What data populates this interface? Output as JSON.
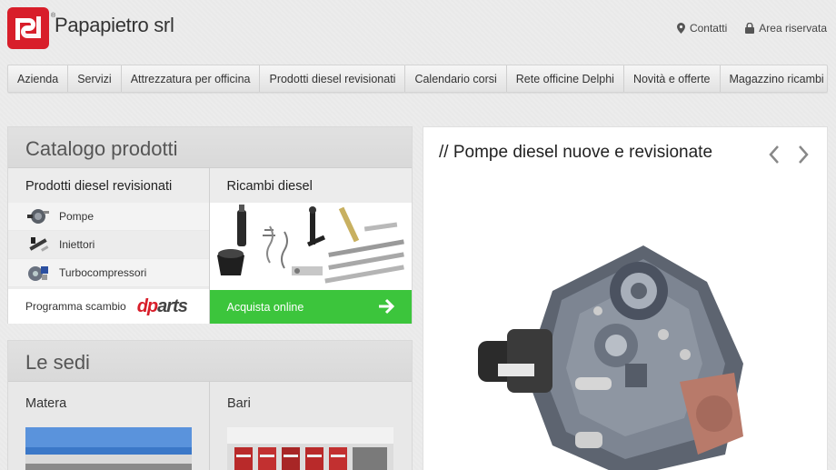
{
  "header": {
    "brand": "Papapietro srl",
    "reg_mark": "®",
    "links": [
      {
        "label": "Contatti",
        "icon": "map-pin-icon"
      },
      {
        "label": "Area riservata",
        "icon": "lock-icon"
      }
    ]
  },
  "nav": {
    "items": [
      "Azienda",
      "Servizi",
      "Attrezzatura per officina",
      "Prodotti diesel revisionati",
      "Calendario corsi",
      "Rete officine Delphi",
      "Novità e offerte",
      "Magazzino ricambi"
    ]
  },
  "catalog": {
    "title": "Catalogo prodotti",
    "left": {
      "title": "Prodotti diesel revisionati",
      "items": [
        "Pompe",
        "Iniettori",
        "Turbocompressori"
      ],
      "exchange_label": "Programma scambio",
      "exchange_logo": {
        "d": "d",
        "p": "p",
        "rest": "arts"
      }
    },
    "right": {
      "title": "Ricambi diesel",
      "buy_label": "Acquista online"
    }
  },
  "sedi": {
    "title": "Le sedi",
    "locations": [
      "Matera",
      "Bari"
    ]
  },
  "slider": {
    "title": "// Pompe diesel nuove e revisionate"
  },
  "colors": {
    "brand_red": "#d81e2a",
    "buy_green": "#3cc53c"
  }
}
